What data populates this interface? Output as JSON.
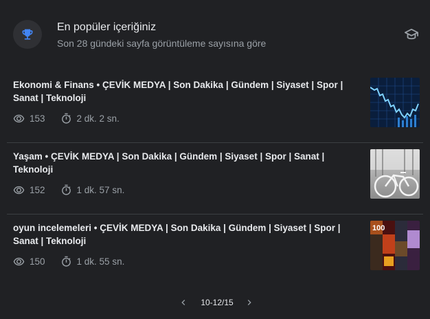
{
  "header": {
    "title": "En popüler içeriğiniz",
    "subtitle": "Son 28 gündeki sayfa görüntüleme sayısına göre"
  },
  "items": [
    {
      "title": "Ekonomi & Finans • ÇEVİK MEDYA | Son Dakika | Gündem | Siyaset | Spor | Sanat | Teknoloji",
      "views": "153",
      "duration": "2 dk. 2 sn."
    },
    {
      "title": "Yaşam • ÇEVİK MEDYA | Son Dakika | Gündem | Siyaset | Spor | Sanat | Teknoloji",
      "views": "152",
      "duration": "1 dk. 57 sn."
    },
    {
      "title": "oyun incelemeleri • ÇEVİK MEDYA | Son Dakika | Gündem | Siyaset | Spor | Sanat | Teknoloji",
      "views": "150",
      "duration": "1 dk. 55 sn."
    }
  ],
  "pagination": {
    "label": "10-12/15"
  },
  "colors": {
    "background": "#202124",
    "accent_blue": "#4285f4",
    "muted_text": "#9aa0a6"
  },
  "icons": [
    "trophy-icon",
    "graduation-cap-icon",
    "eye-icon",
    "timer-icon",
    "chevron-left-icon",
    "chevron-right-icon"
  ]
}
